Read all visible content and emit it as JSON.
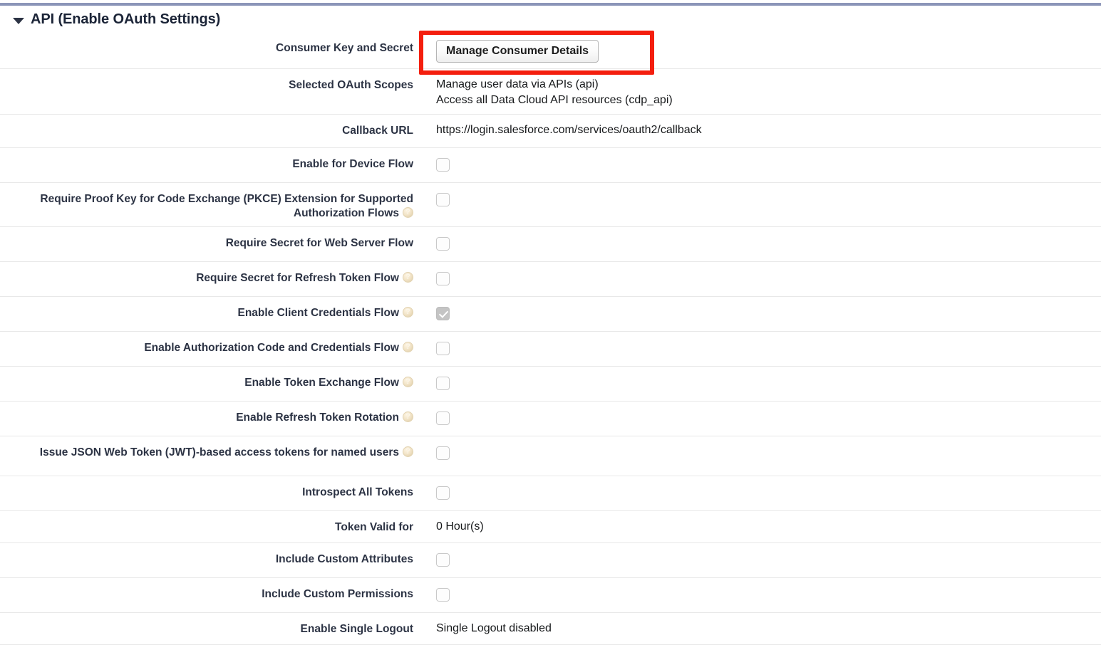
{
  "section": {
    "title": "API (Enable OAuth Settings)",
    "twisty_icon": "caret-down-icon",
    "expanded": true
  },
  "colors": {
    "top_rule": "#8b95b8",
    "highlight": "#f41e0e",
    "label_text": "#2c3344",
    "value_text": "#16181a",
    "row_divider": "#e8e8e8"
  },
  "highlight": {
    "target": "manage-consumer-details-button",
    "shape": "rectangle",
    "color": "#f41e0e"
  },
  "rows": [
    {
      "label": "Consumer Key and Secret",
      "type": "button",
      "button_label": "Manage Consumer Details",
      "help": false
    },
    {
      "label": "Selected OAuth Scopes",
      "type": "multiline",
      "values": [
        "Manage user data via APIs (api)",
        "Access all Data Cloud API resources (cdp_api)"
      ],
      "help": false
    },
    {
      "label": "Callback URL",
      "type": "text",
      "value": "https://login.salesforce.com/services/oauth2/callback",
      "help": false
    },
    {
      "label": "Enable for Device Flow",
      "type": "checkbox",
      "checked": false,
      "disabled": false,
      "help": false
    },
    {
      "label": "Require Proof Key for Code Exchange (PKCE) Extension for Supported Authorization Flows",
      "type": "checkbox",
      "checked": false,
      "disabled": false,
      "help": true
    },
    {
      "label": "Require Secret for Web Server Flow",
      "type": "checkbox",
      "checked": false,
      "disabled": false,
      "help": false
    },
    {
      "label": "Require Secret for Refresh Token Flow",
      "type": "checkbox",
      "checked": false,
      "disabled": false,
      "help": true
    },
    {
      "label": "Enable Client Credentials Flow",
      "type": "checkbox",
      "checked": true,
      "disabled": true,
      "help": true
    },
    {
      "label": "Enable Authorization Code and Credentials Flow",
      "type": "checkbox",
      "checked": false,
      "disabled": false,
      "help": true
    },
    {
      "label": "Enable Token Exchange Flow",
      "type": "checkbox",
      "checked": false,
      "disabled": false,
      "help": true
    },
    {
      "label": "Enable Refresh Token Rotation",
      "type": "checkbox",
      "checked": false,
      "disabled": false,
      "help": true
    },
    {
      "label": "Issue JSON Web Token (JWT)-based access tokens for named users",
      "type": "checkbox",
      "checked": false,
      "disabled": false,
      "help": true
    },
    {
      "label": "Introspect All Tokens",
      "type": "checkbox",
      "checked": false,
      "disabled": false,
      "help": false
    },
    {
      "label": "Token Valid for",
      "type": "text",
      "value": "0 Hour(s)",
      "help": false
    },
    {
      "label": "Include Custom Attributes",
      "type": "checkbox",
      "checked": false,
      "disabled": false,
      "help": false
    },
    {
      "label": "Include Custom Permissions",
      "type": "checkbox",
      "checked": false,
      "disabled": false,
      "help": false
    },
    {
      "label": "Enable Single Logout",
      "type": "text",
      "value": "Single Logout disabled",
      "help": false
    }
  ]
}
